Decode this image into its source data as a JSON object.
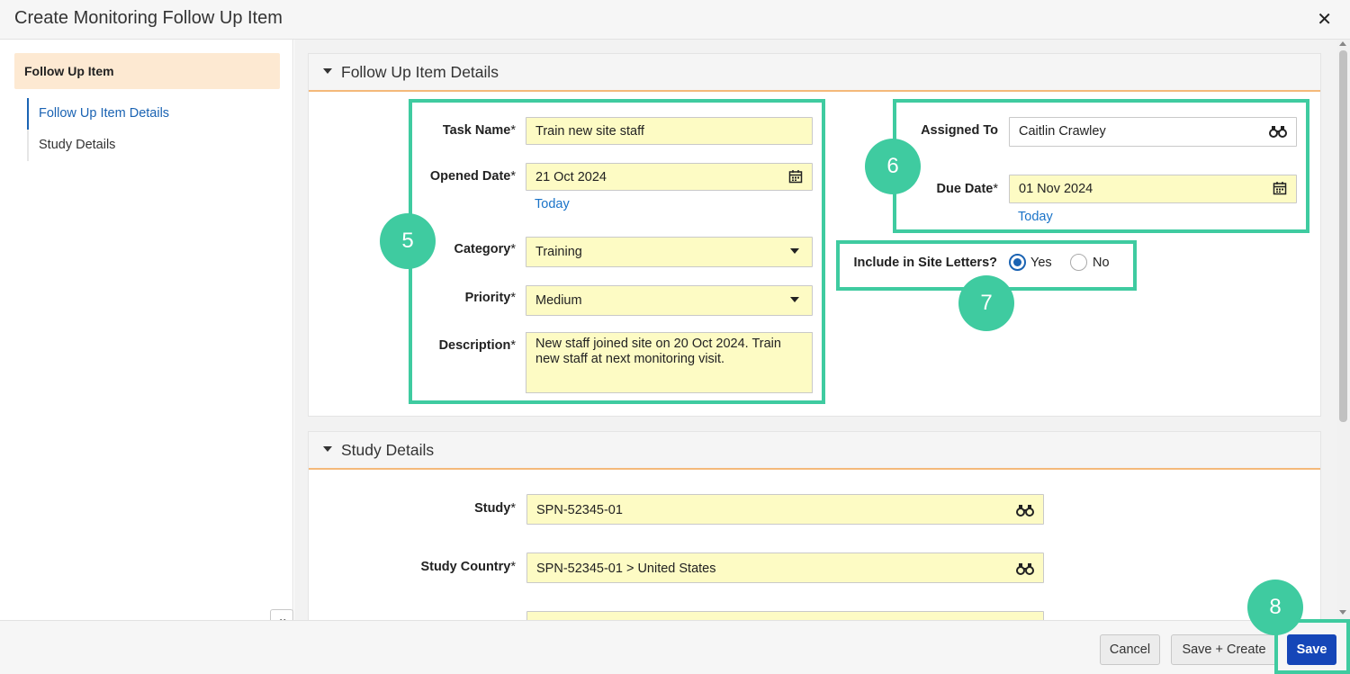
{
  "dialog": {
    "title": "Create Monitoring Follow Up Item",
    "close_symbol": "✕"
  },
  "sidebar": {
    "header": "Follow Up Item",
    "items": [
      {
        "label": "Follow Up Item Details",
        "active": true
      },
      {
        "label": "Study Details",
        "active": false
      }
    ],
    "collapse_symbol": "«"
  },
  "follow_up": {
    "section_title": "Follow Up Item Details",
    "task_name": {
      "label": "Task Name",
      "value": "Train new site staff"
    },
    "opened_date": {
      "label": "Opened Date",
      "value": "21 Oct 2024",
      "today": "Today"
    },
    "category": {
      "label": "Category",
      "value": "Training"
    },
    "priority": {
      "label": "Priority",
      "value": "Medium"
    },
    "description": {
      "label": "Description",
      "value": "New staff joined site on 20 Oct 2024. Train new staff at next monitoring visit."
    },
    "assigned_to": {
      "label": "Assigned To",
      "value": "Caitlin Crawley"
    },
    "due_date": {
      "label": "Due Date",
      "value": "01 Nov 2024",
      "today": "Today"
    },
    "site_letters": {
      "label": "Include in Site Letters?",
      "yes": "Yes",
      "no": "No",
      "selected": "Yes"
    },
    "required_mark": "*"
  },
  "study": {
    "section_title": "Study Details",
    "study": {
      "label": "Study",
      "value": "SPN-52345-01"
    },
    "study_country": {
      "label": "Study Country",
      "value": "SPN-52345-01 > United States"
    }
  },
  "annotations": {
    "b5": "5",
    "b6": "6",
    "b7": "7",
    "b8": "8",
    "color": "#3fcba0"
  },
  "footer": {
    "cancel": "Cancel",
    "save_create": "Save + Create",
    "save": "Save"
  },
  "colors": {
    "required_field": "#fdfbc4",
    "primary": "#1546b8",
    "link": "#1a73c8",
    "sidebar_header": "#fde9d2",
    "section_border": "#f4b97a"
  },
  "icons": {
    "date": "calendar-icon",
    "lookup": "binoculars-icon",
    "dropdown": "chevron-down-icon"
  }
}
